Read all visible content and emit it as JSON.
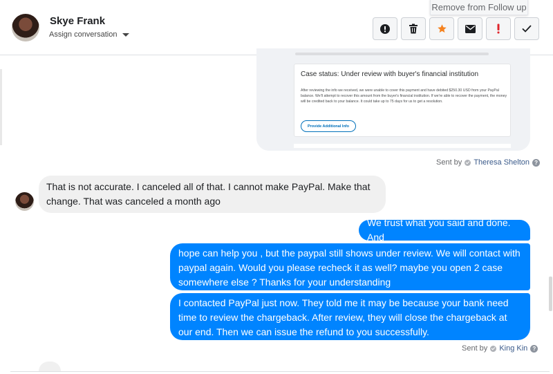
{
  "header": {
    "contact_name": "Skye Frank",
    "assign_label": "Assign conversation",
    "tooltip": "Remove from Follow up",
    "actions": [
      {
        "name": "spam",
        "icon": "alert-circle-icon"
      },
      {
        "name": "delete",
        "icon": "trash-icon"
      },
      {
        "name": "follow-up",
        "icon": "star-icon",
        "color": "#f5821f"
      },
      {
        "name": "email",
        "icon": "envelope-icon"
      },
      {
        "name": "important",
        "icon": "exclamation-icon",
        "color": "#e0262c"
      },
      {
        "name": "done",
        "icon": "checkmark-icon"
      }
    ]
  },
  "attachment": {
    "case_title": "Case status: Under review with buyer's financial institution",
    "case_body": "After reviewing the info we received, we were unable to cover this payment and have debited $250.30 USD from your PayPal balance. We'll attempt to recover this amount from the buyer's financial institution. If we're able to recover the payment, the money will be credited back to your balance. It could take up to 75 days for us to get a resolution.",
    "case_button": "Provide Additional Info"
  },
  "messages": {
    "sent_by_label_1": "Sent by",
    "agent_1": "Theresa Shelton",
    "incoming_1": "That is not accurate. I canceled all of that. I cannot make PayPal. Make that change. That was canceled a month ago",
    "outgoing_1": "We trust what you said and done. And",
    "outgoing_2": "hope can help you , but the paypal still shows under review. We will contact with paypal again. Would you  please recheck it as well? maybe you open 2 case somewhere else ? Thanks for your understanding",
    "outgoing_3": "I contacted PayPal just now. They told me it may be because your bank need time to review the chargeback. After review, they will close the chargeback at our end. Then we can issue the refund to you successfully.",
    "sent_by_label_2": "Sent by",
    "agent_2": "King Kin"
  },
  "colors": {
    "outgoing_bubble": "#0084ff",
    "incoming_bubble": "#f0f0f0",
    "star": "#f5821f",
    "important": "#e0262c"
  }
}
